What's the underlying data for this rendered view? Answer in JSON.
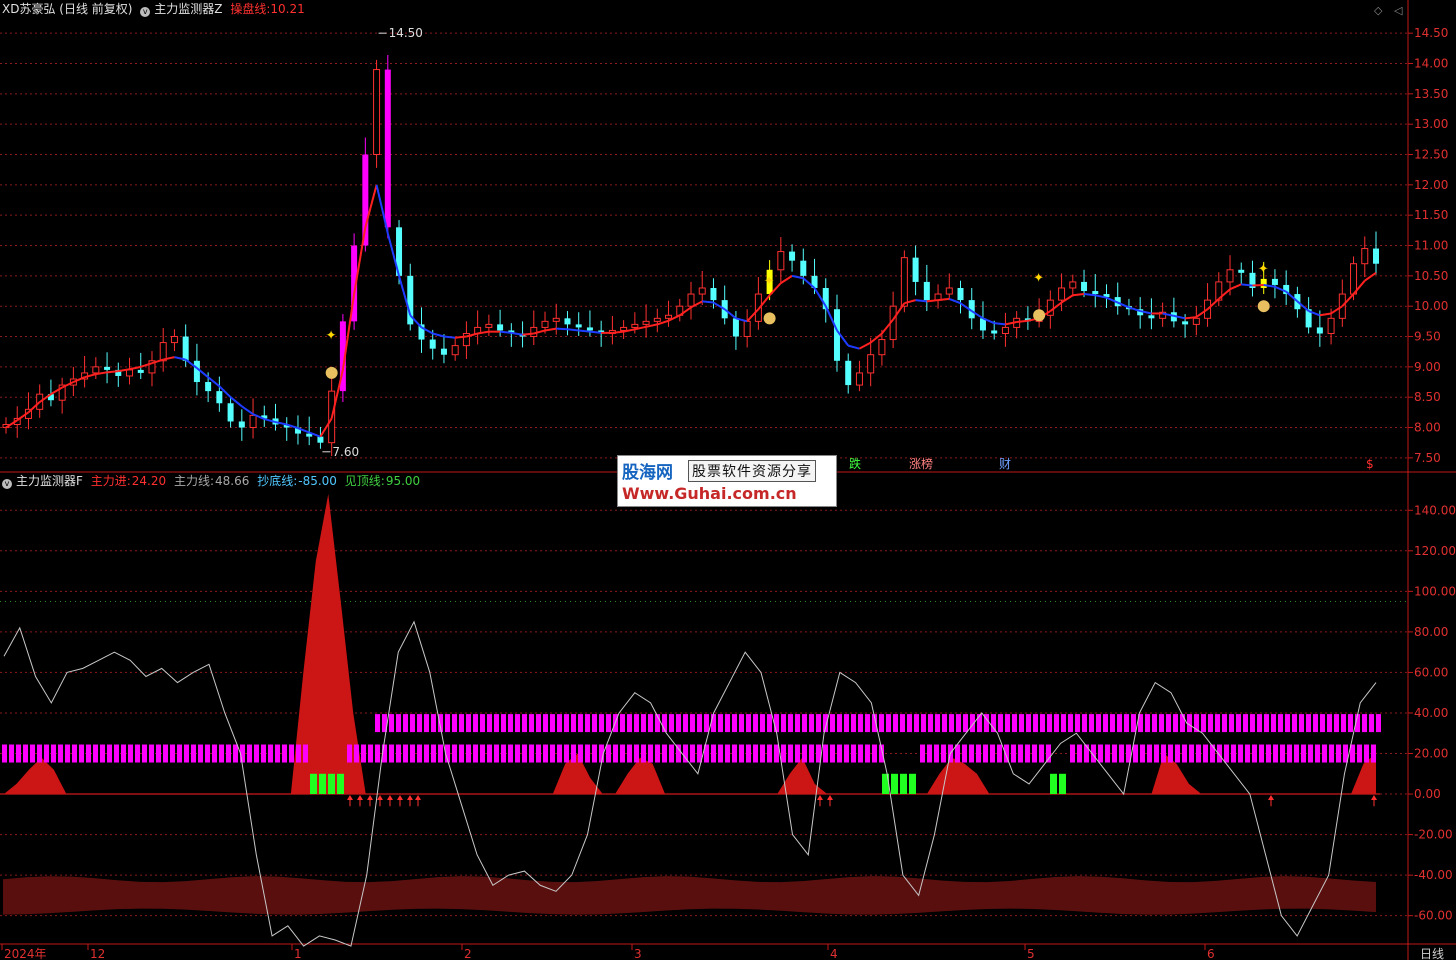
{
  "top_header": {
    "stock": "XD苏豪弘 (日线 前复权)",
    "indicator": "主力监测器Z",
    "line_label": "操盘线:",
    "line_value": "10.21"
  },
  "bottom_header": {
    "indicator": "主力监测器F",
    "items": [
      {
        "label": "主力进:",
        "value": "24.20",
        "color": "#ff3030"
      },
      {
        "label": "主力线:",
        "value": "48.66",
        "color": "#b0b0b0"
      },
      {
        "label": "抄底线:",
        "value": "-85.00",
        "color": "#50c8ff"
      },
      {
        "label": "见顶线:",
        "value": "95.00",
        "color": "#40d040"
      }
    ]
  },
  "watermark": {
    "name": "股海网",
    "slogan": "股票软件资源分享",
    "url": "Www.Guhai.com.cn"
  },
  "event_labels": [
    "跌",
    "涨榜",
    "财",
    "$"
  ],
  "x_axis_labels": [
    "2024年",
    "12",
    "1",
    "2",
    "3",
    "4",
    "5",
    "6"
  ],
  "period_label": "日线",
  "colors": {
    "up": "#ff3030",
    "down": "#54ffff",
    "highlight": "#ff00ff",
    "signal": "#ffff00",
    "ma_up": "#ff2020",
    "ma_down": "#1e3cff",
    "grid": "#8b1a1a",
    "axis": "#c01818"
  },
  "chart_data": [
    {
      "type": "candlestick",
      "title": "XD苏豪弘 (日线 前复权)",
      "ylim": [
        7.3,
        14.75
      ],
      "yticks": [
        7.5,
        8.0,
        8.5,
        9.0,
        9.5,
        10.0,
        10.5,
        11.0,
        11.5,
        12.0,
        12.5,
        13.0,
        13.5,
        14.0,
        14.5
      ],
      "annotations": [
        {
          "label": "14.50",
          "kind": "high"
        },
        {
          "label": "7.60",
          "kind": "low"
        }
      ],
      "close_path": [
        8.05,
        8.15,
        8.3,
        8.55,
        8.45,
        8.7,
        8.8,
        8.9,
        9.0,
        8.95,
        8.85,
        8.95,
        8.9,
        9.1,
        9.4,
        9.5,
        9.1,
        8.75,
        8.6,
        8.4,
        8.1,
        8.0,
        8.2,
        8.15,
        8.05,
        8.0,
        7.9,
        7.85,
        7.75,
        8.6,
        9.75,
        11.0,
        12.5,
        13.9,
        11.3,
        10.5,
        9.7,
        9.45,
        9.3,
        9.2,
        9.35,
        9.55,
        9.65,
        9.7,
        9.6,
        9.55,
        9.5,
        9.65,
        9.75,
        9.8,
        9.7,
        9.65,
        9.6,
        9.55,
        9.6,
        9.65,
        9.7,
        9.75,
        9.8,
        9.85,
        10.0,
        10.2,
        10.3,
        10.1,
        9.8,
        9.5,
        9.75,
        10.2,
        10.6,
        10.9,
        10.75,
        10.5,
        10.3,
        9.95,
        9.1,
        8.7,
        8.9,
        9.2,
        9.45,
        10.0,
        10.8,
        10.4,
        10.1,
        10.2,
        10.3,
        10.1,
        9.8,
        9.6,
        9.55,
        9.65,
        9.8,
        9.75,
        9.85,
        10.1,
        10.3,
        10.4,
        10.25,
        10.2,
        10.15,
        10.0,
        9.95,
        9.85,
        9.8,
        9.9,
        9.75,
        9.7,
        9.8,
        10.1,
        10.4,
        10.6,
        10.55,
        10.3,
        10.45,
        10.35,
        10.2,
        9.95,
        9.65,
        9.55,
        9.8,
        10.2,
        10.7,
        10.95,
        10.7
      ],
      "ma_path": [
        8.0,
        8.12,
        8.25,
        8.42,
        8.55,
        8.66,
        8.75,
        8.83,
        8.88,
        8.91,
        8.93,
        8.96,
        9.0,
        9.06,
        9.12,
        9.16,
        9.12,
        8.98,
        8.83,
        8.68,
        8.5,
        8.35,
        8.22,
        8.14,
        8.09,
        8.05,
        7.99,
        7.92,
        7.85,
        8.15,
        8.95,
        10.2,
        11.3,
        12.0,
        11.2,
        10.5,
        9.85,
        9.65,
        9.55,
        9.5,
        9.48,
        9.5,
        9.55,
        9.58,
        9.58,
        9.56,
        9.53,
        9.55,
        9.6,
        9.63,
        9.62,
        9.6,
        9.58,
        9.56,
        9.56,
        9.58,
        9.62,
        9.66,
        9.7,
        9.76,
        9.85,
        9.98,
        10.08,
        10.06,
        9.95,
        9.8,
        9.75,
        9.95,
        10.18,
        10.38,
        10.5,
        10.46,
        10.3,
        10.0,
        9.6,
        9.35,
        9.3,
        9.4,
        9.55,
        9.78,
        10.05,
        10.1,
        10.08,
        10.1,
        10.12,
        10.05,
        9.92,
        9.8,
        9.72,
        9.7,
        9.74,
        9.76,
        9.8,
        9.92,
        10.06,
        10.18,
        10.2,
        10.18,
        10.14,
        10.06,
        9.98,
        9.92,
        9.88,
        9.88,
        9.84,
        9.8,
        9.82,
        9.95,
        10.12,
        10.28,
        10.36,
        10.34,
        10.35,
        10.32,
        10.24,
        10.08,
        9.92,
        9.85,
        9.88,
        10.0,
        10.2,
        10.42,
        10.55
      ],
      "highlight_candles": [
        {
          "index": 30,
          "price": 11.0
        },
        {
          "index": 31,
          "price": 12.5
        },
        {
          "index": 32,
          "price": 13.9
        },
        {
          "index": 34,
          "price": 11.0
        },
        {
          "index": 68,
          "price": 10.9
        },
        {
          "index": 112,
          "price": 10.7
        }
      ]
    },
    {
      "type": "line",
      "title": "主力监测器F",
      "ylim": [
        -72,
        150
      ],
      "yticks": [
        -60.0,
        -40.0,
        -20.0,
        0.0,
        20.0,
        40.0,
        60.0,
        80.0,
        100.0,
        120.0,
        140.0
      ],
      "series": [
        {
          "name": "主力线",
          "values": [
            68,
            82,
            58,
            45,
            60,
            62,
            66,
            70,
            66,
            58,
            62,
            55,
            60,
            64,
            40,
            20,
            -30,
            -70,
            -65,
            -75,
            -70,
            -72,
            -75,
            -40,
            20,
            70,
            85,
            60,
            20,
            -5,
            -30,
            -45,
            -40,
            -38,
            -45,
            -48,
            -40,
            -20,
            20,
            40,
            50,
            45,
            30,
            20,
            10,
            40,
            55,
            70,
            60,
            30,
            -20,
            -30,
            30,
            60,
            55,
            45,
            10,
            -40,
            -50,
            -20,
            20,
            30,
            40,
            30,
            10,
            5,
            15,
            25,
            30,
            20,
            10,
            0,
            40,
            55,
            50,
            35,
            30,
            20,
            10,
            0,
            -30,
            -60,
            -70,
            -55,
            -40,
            10,
            45,
            55
          ]
        },
        {
          "name": "主力进",
          "values": [
            0,
            5,
            12,
            18,
            12,
            0,
            0,
            0,
            0,
            0,
            0,
            0,
            0,
            0,
            0,
            0,
            0,
            0,
            0,
            0,
            0,
            0,
            0,
            0,
            60,
            115,
            148,
            95,
            40,
            0,
            0,
            0,
            0,
            0,
            0,
            0,
            0,
            0,
            0,
            0,
            0,
            0,
            0,
            0,
            0,
            15,
            20,
            8,
            0,
            0,
            10,
            18,
            15,
            0,
            0,
            0,
            0,
            0,
            0,
            0,
            0,
            0,
            0,
            10,
            18,
            5,
            0,
            0,
            0,
            0,
            0,
            0,
            0,
            0,
            0,
            10,
            18,
            15,
            10,
            0,
            0,
            0,
            0,
            0,
            0,
            0,
            0,
            0,
            0,
            0,
            0,
            0,
            0,
            20,
            15,
            5,
            0,
            0,
            0,
            0,
            0,
            0,
            0,
            0,
            0,
            0,
            0,
            0,
            0,
            15,
            20
          ]
        },
        {
          "name": "抄底线",
          "values": [
            -85
          ]
        },
        {
          "name": "见顶线",
          "values": [
            95
          ]
        }
      ]
    }
  ]
}
